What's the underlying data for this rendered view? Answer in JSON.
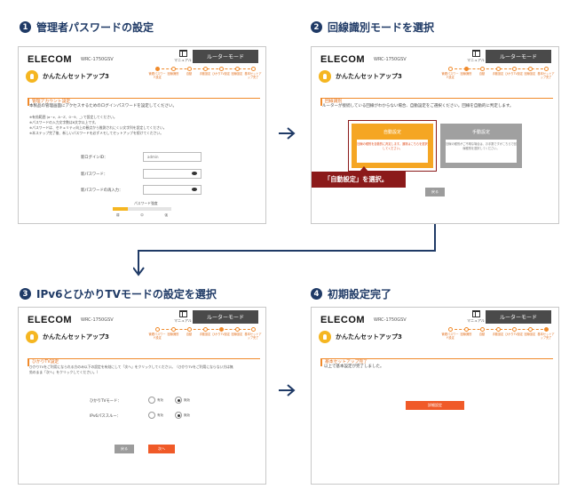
{
  "steps": [
    {
      "num": "1",
      "title": "管理者パスワードの設定"
    },
    {
      "num": "2",
      "title": "回線識別モードを選択"
    },
    {
      "num": "3",
      "title": "IPv6とひかりTVモードの設定を選択"
    },
    {
      "num": "4",
      "title": "初期設定完了"
    }
  ],
  "common": {
    "logo": "ELECOM",
    "model": "WRC-1750GSV",
    "manual": "マニュアル",
    "router_mode": "ルーターモード",
    "app_title": "かんたんセットアップ3",
    "progress": [
      "管理パスワード設定",
      "回線識別",
      "自動",
      "手動設定",
      "ひかりTV設定",
      "回線設定",
      "基本セットアップ完了"
    ]
  },
  "panel1": {
    "subhead": "管理アカウント設定",
    "intro": "本製品の管理画面にアクセスするためのログインパスワードを設定してください。",
    "notes": [
      "※有効範囲 (a~z、A~Z、0~9、_) で設定してください。",
      "※パスワードの入力文字数は6文字以上です。",
      "※パスワードは、セキュリティ向上の観点から推測されにくい文字列を設定してください。",
      "※本ステップ完了後、新しいパスワードを必ずメモしてセットアップを続けてください。"
    ],
    "login_id_label": "新ログインID：",
    "login_id_value": "admin",
    "password_label": "新パスワード：",
    "password_confirm_label": "新パスワードの再入力：",
    "strength_label": "パスワード強度",
    "strength_marks": [
      "弱",
      "中",
      "強"
    ],
    "strength_level": 0.25
  },
  "panel2": {
    "subhead": "回線識別",
    "intro": "ルーターが接続している回線がわからない場合、自動設定をご選択ください。回線を自動的に判定します。",
    "auto_title": "自動設定",
    "auto_desc": "回線の種別を自動的に判定します。通常はこちらを選択してください。",
    "manual_title": "手動設定",
    "manual_desc": "回線の種別がご不明な場合は、お手数ですがこちらで回線種別を選択してください。",
    "callout": "「自動設定」を選択。",
    "back": "戻る"
  },
  "panel3": {
    "subhead": "ひかりTV設定",
    "intro": "ひかりTVをご利用になられる方のみ以下の設定を有効にして「次へ」をクリックしてください。（ひかりTVをご利用にならない方は無効のまま「次へ」をクリックしてください。）",
    "tv_mode_label": "ひかりTVモード：",
    "passthrough_label": "IPv6パススルー：",
    "opt_on": "有効",
    "opt_off": "無効",
    "back": "戻る",
    "next": "次へ"
  },
  "panel4": {
    "subhead": "基本セットアップ完了",
    "intro": "以上で基本設定が完了しました。",
    "finish": "詳細設定"
  },
  "colors": {
    "accent": "#f08a2b",
    "navy": "#1f3a66",
    "callout": "#8b1a1a"
  }
}
